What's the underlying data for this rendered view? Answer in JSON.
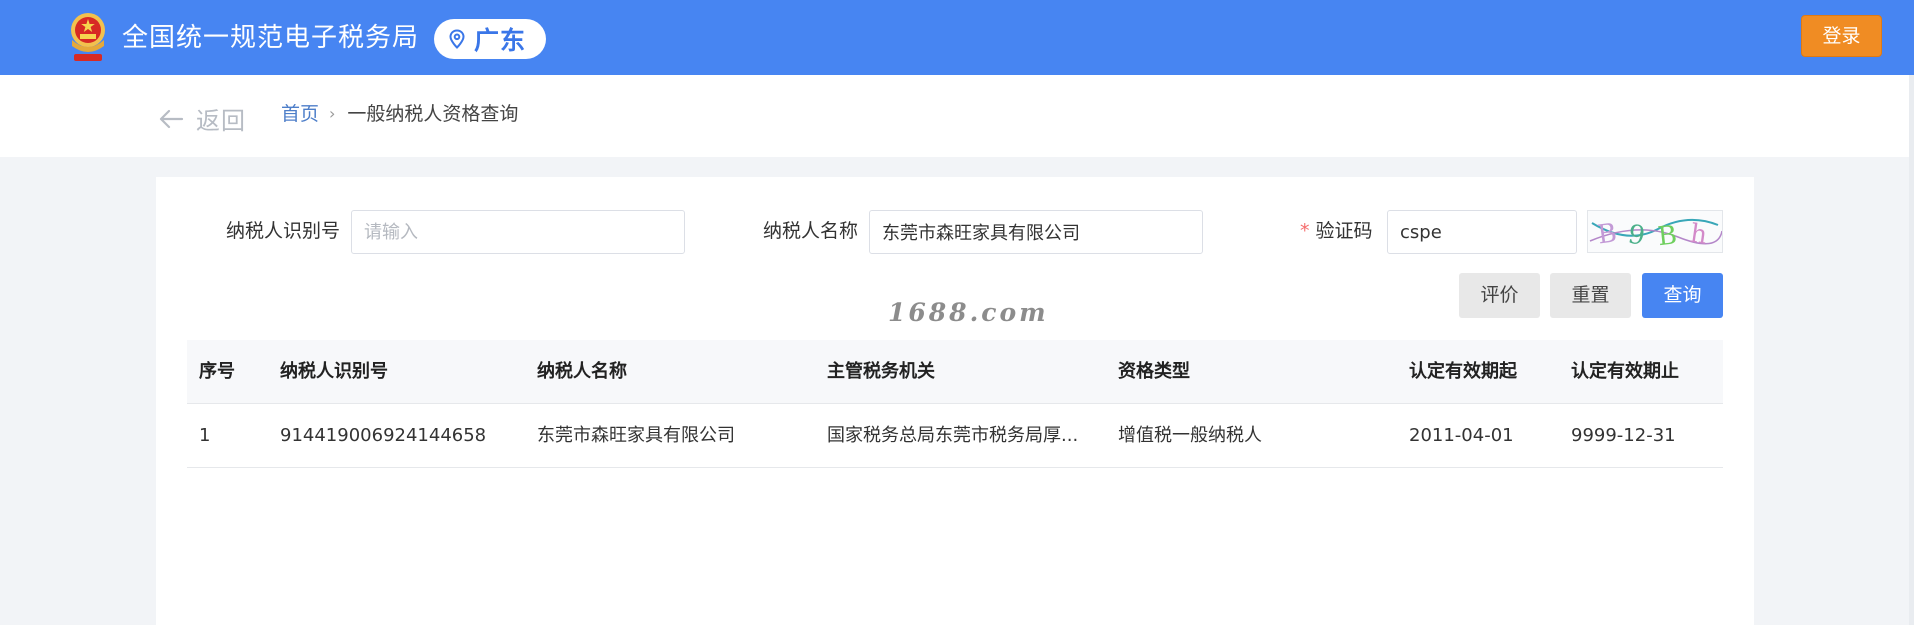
{
  "header": {
    "app_title": "全国统一规范电子税务局",
    "region": "广东",
    "login_label": "登录"
  },
  "nav": {
    "back_label": "返回",
    "breadcrumb": {
      "home": "首页",
      "separator": "›",
      "current": "一般纳税人资格查询"
    }
  },
  "form": {
    "taxpayer_id": {
      "label": "纳税人识别号",
      "placeholder": "请输入",
      "value": ""
    },
    "taxpayer_name": {
      "label": "纳税人名称",
      "value": "东莞市森旺家具有限公司"
    },
    "captcha": {
      "required_mark": "*",
      "label": "验证码",
      "value": "cspe",
      "image_text": "B9Bh"
    },
    "buttons": {
      "evaluate": "评价",
      "reset": "重置",
      "query": "查询"
    }
  },
  "watermark": "1688.com",
  "table": {
    "columns": [
      "序号",
      "纳税人识别号",
      "纳税人名称",
      "主管税务机关",
      "资格类型",
      "认定有效期起",
      "认定有效期止"
    ],
    "rows": [
      [
        "1",
        "914419006924144658",
        "东莞市森旺家具有限公司",
        "国家税务总局东莞市税务局厚...",
        "增值税一般纳税人",
        "2011-04-01",
        "9999-12-31"
      ]
    ]
  },
  "colors": {
    "header_blue": "#4785f2",
    "login_orange": "#f08c23",
    "link_blue": "#4d7ec9",
    "required_red": "#f56c6c"
  },
  "icons": {
    "emblem": "national-emblem-icon",
    "region": "location-pin-icon",
    "back": "arrow-left-icon"
  }
}
